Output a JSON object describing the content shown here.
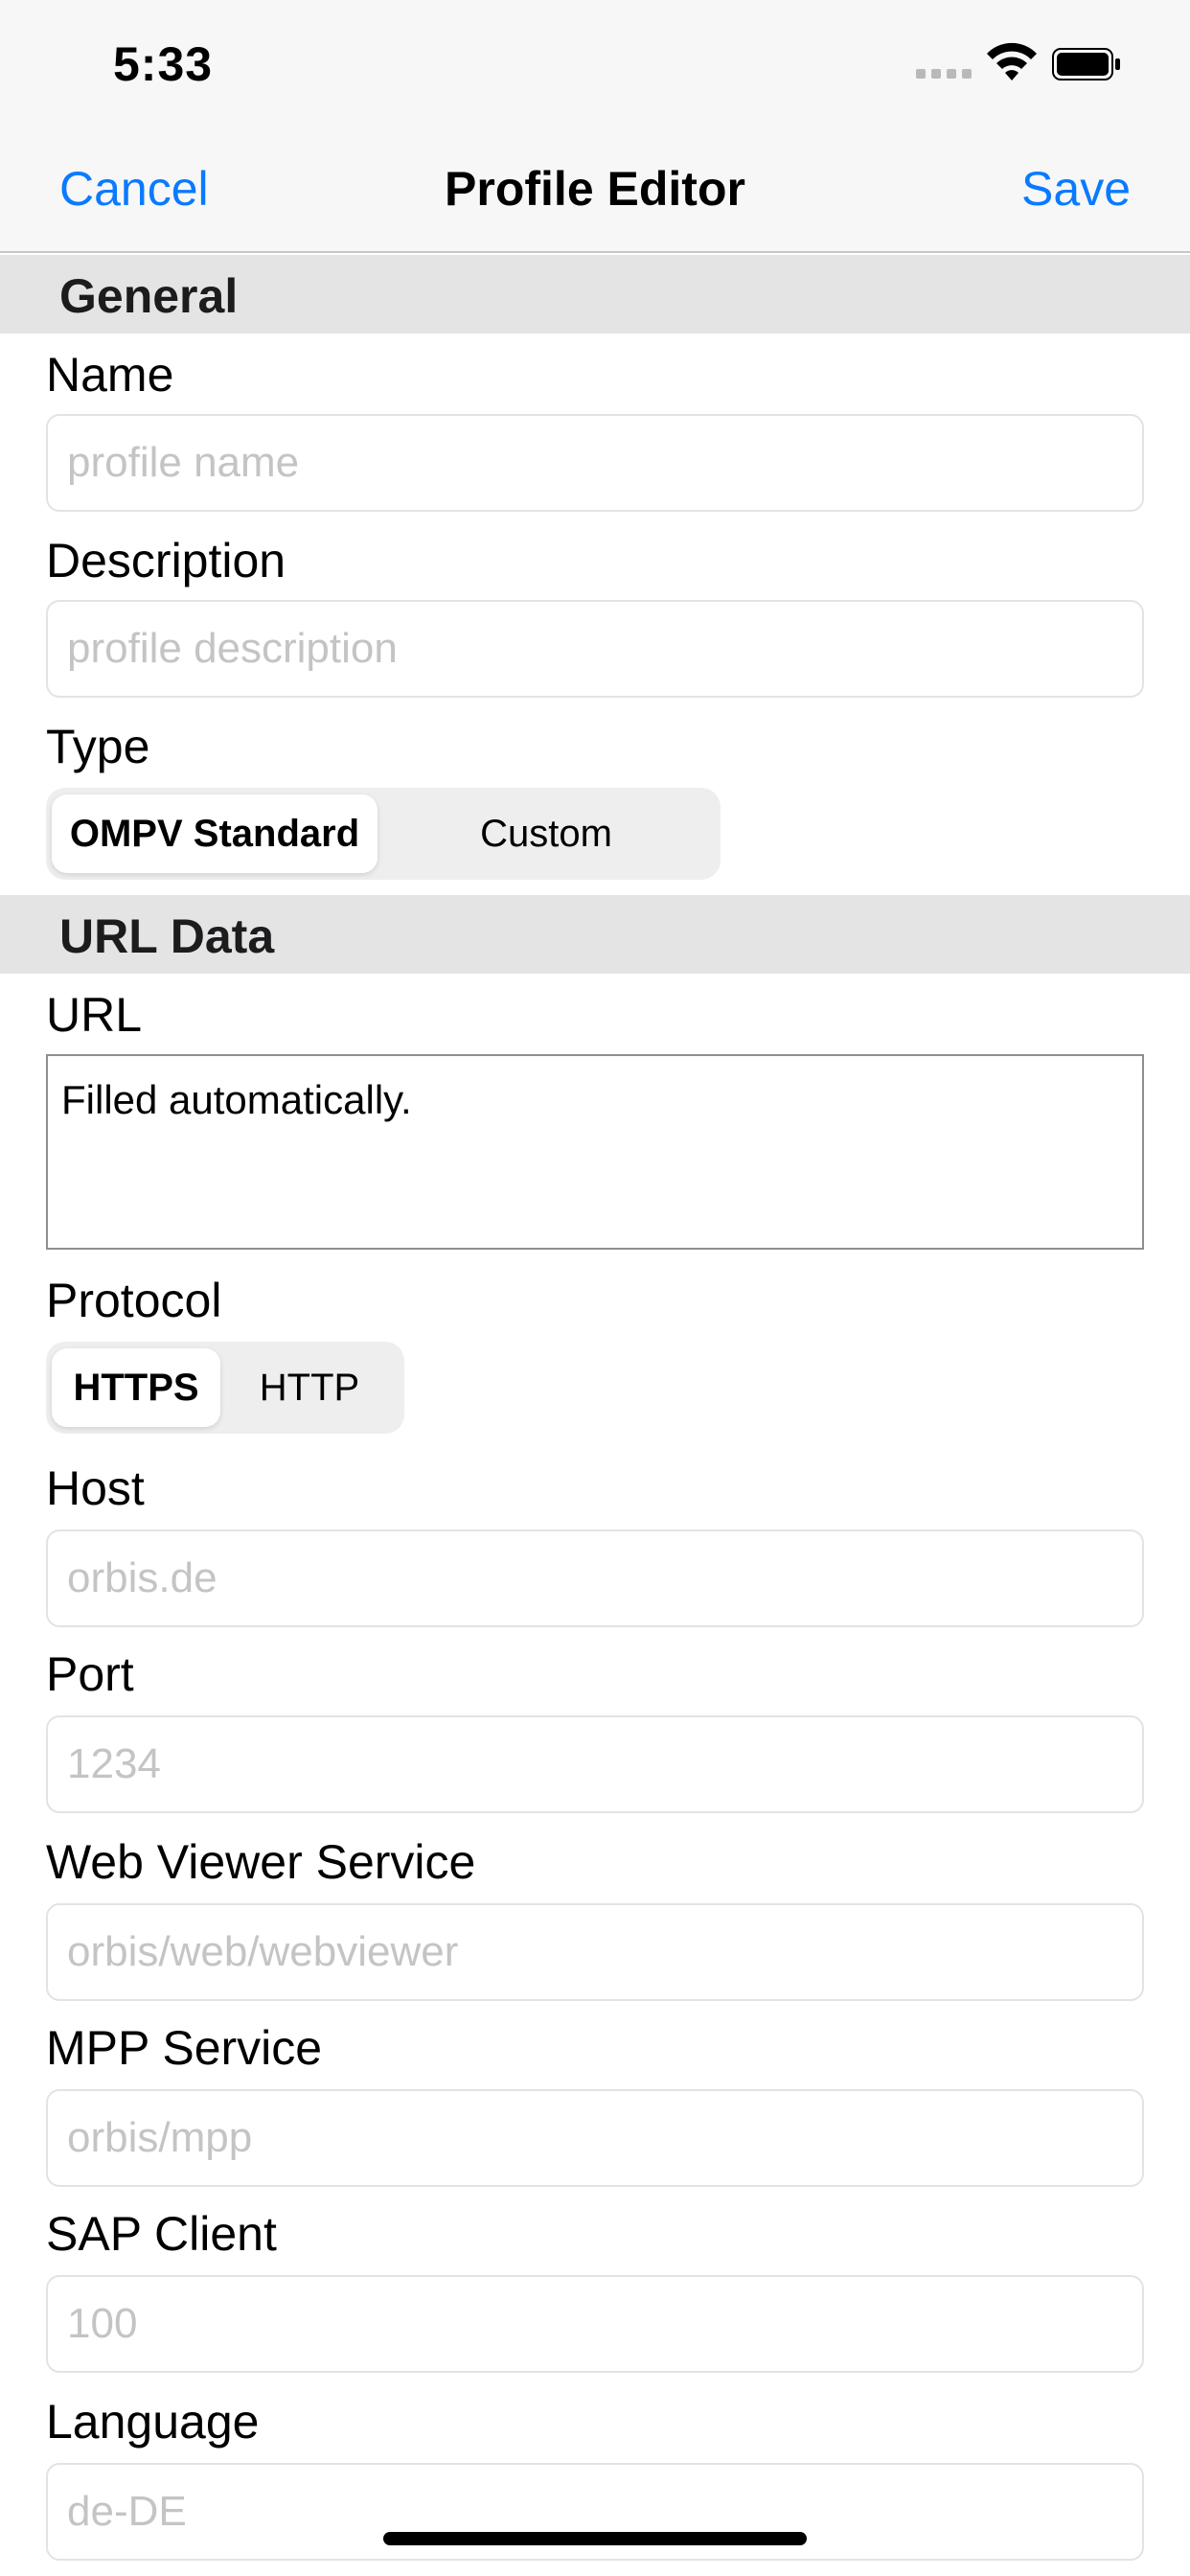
{
  "status_bar": {
    "time": "5:33",
    "icons": [
      "signal-icon",
      "wifi-icon",
      "battery-icon"
    ]
  },
  "nav": {
    "cancel_label": "Cancel",
    "title": "Profile Editor",
    "save_label": "Save"
  },
  "colors": {
    "accent": "#0a7aff",
    "section_bg": "#e4e4e4",
    "nav_bg": "#f7f7f7",
    "placeholder": "#c4c4c7"
  },
  "general": {
    "header": "General",
    "name": {
      "label": "Name",
      "value": "",
      "placeholder": "profile name"
    },
    "description": {
      "label": "Description",
      "value": "",
      "placeholder": "profile description"
    },
    "type": {
      "label": "Type",
      "options": [
        "OMPV Standard",
        "Custom"
      ],
      "selected": "OMPV Standard"
    }
  },
  "url_data": {
    "header": "URL Data",
    "url": {
      "label": "URL",
      "value": "Filled automatically."
    },
    "protocol": {
      "label": "Protocol",
      "options": [
        "HTTPS",
        "HTTP"
      ],
      "selected": "HTTPS"
    },
    "host": {
      "label": "Host",
      "value": "",
      "placeholder": "orbis.de"
    },
    "port": {
      "label": "Port",
      "value": "",
      "placeholder": "1234"
    },
    "web_viewer_service": {
      "label": "Web Viewer Service",
      "value": "",
      "placeholder": "orbis/web/webviewer"
    },
    "mpp_service": {
      "label": "MPP Service",
      "value": "",
      "placeholder": "orbis/mpp"
    },
    "sap_client": {
      "label": "SAP Client",
      "value": "",
      "placeholder": "100"
    },
    "language": {
      "label": "Language",
      "value": "",
      "placeholder": "de-DE"
    }
  }
}
